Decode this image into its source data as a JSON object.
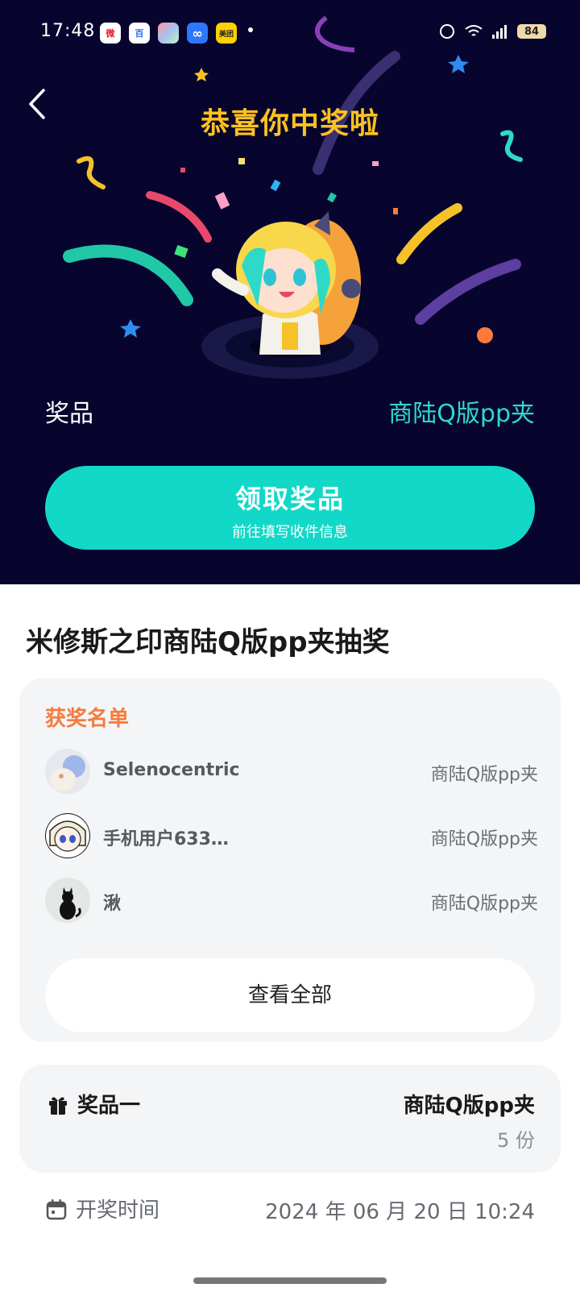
{
  "status_bar": {
    "time": "17:48",
    "battery": "84",
    "apps": [
      {
        "name": "weibo-app-icon",
        "glyph": "微",
        "color": "#f6c229"
      },
      {
        "name": "baidu-app-icon",
        "glyph": "百",
        "color": "#2f6cf6"
      },
      {
        "name": "gallery-app-icon",
        "glyph": "",
        "color": "#7ab8ff"
      },
      {
        "name": "infinity-app-icon",
        "glyph": "∞",
        "color": "#2f76ff"
      },
      {
        "name": "meituan-app-icon",
        "glyph": "美团",
        "color": "#ffd100"
      }
    ]
  },
  "hero": {
    "title": "恭喜你中奖啦",
    "prize_label": "奖品",
    "prize_value": "商陆Q版pp夹",
    "claim_button": {
      "title": "领取奖品",
      "subtitle": "前往填写收件信息"
    }
  },
  "lottery": {
    "title": "米修斯之印商陆Q版pp夹抽奖"
  },
  "winners": {
    "heading": "获奖名单",
    "rows": [
      {
        "name": "Selenocentric",
        "prize": "商陆Q版pp夹"
      },
      {
        "name": "手机用户633…",
        "prize": "商陆Q版pp夹"
      },
      {
        "name": "湫",
        "prize": "商陆Q版pp夹"
      }
    ],
    "view_all": "查看全部"
  },
  "prize_info": {
    "label": "奖品一",
    "name": "商陆Q版pp夹",
    "count": "5 份"
  },
  "draw": {
    "label": "开奖时间",
    "time": "2024 年 06 月 20 日 10:24"
  },
  "colors": {
    "hero_bg": "#07052e",
    "accent_teal": "#12d8c8",
    "title_gold": "#ffc21f",
    "winners_orange": "#f57b3d"
  }
}
